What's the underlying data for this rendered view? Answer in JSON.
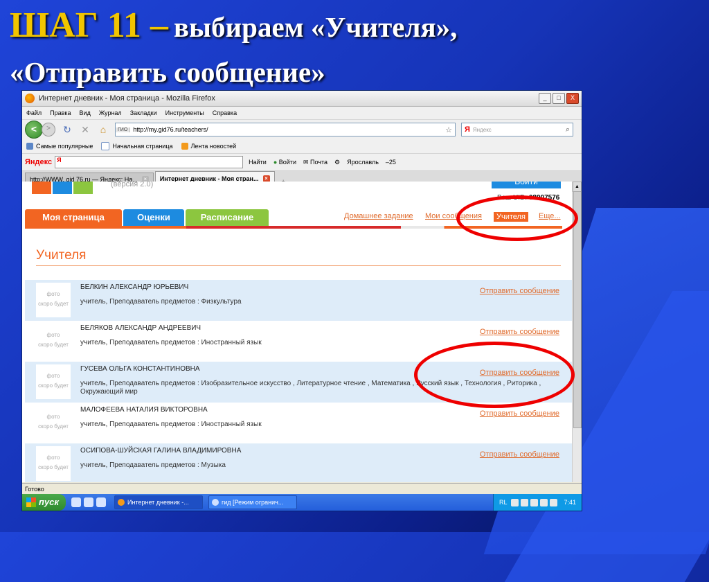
{
  "slide": {
    "title_step": "ШАГ 11 –",
    "title_rest": "выбираем «Учителя»,",
    "title_line2": "«Отправить сообщение»"
  },
  "window": {
    "title": "Интернет дневник - Моя страница - Mozilla Firefox",
    "buttons": [
      "_",
      "□",
      "X"
    ]
  },
  "menu": [
    "Файл",
    "Правка",
    "Вид",
    "Журнал",
    "Закладки",
    "Инструменты",
    "Справка"
  ],
  "nav": {
    "back": "<",
    "forward": ">",
    "url_prefix": "ГИО",
    "url": "http://my.gid76.ru/teachers/",
    "search_engine": "Я",
    "search_placeholder": "Яндекс"
  },
  "bookmarks": [
    "Самые популярные",
    "Начальная страница",
    "Лента новостей"
  ],
  "yandex_bar": {
    "logo": "Яндекс",
    "input_prefix": "Я",
    "items": [
      "Найти",
      "Войти",
      "Почта",
      "Ярославль",
      "–25"
    ]
  },
  "tabs": [
    {
      "label": "http://WWW. gid 76.ru — Яндекс: На...",
      "active": false
    },
    {
      "label": "Интернет дневник - Моя стран...",
      "active": true
    }
  ],
  "site": {
    "subtitle": "(версия 2.0)",
    "login_button": "Войти",
    "uid_label": "Ваш UID:",
    "uid_value": "08907576",
    "nav_tabs": [
      {
        "label": "Моя страница",
        "color": "#f26522"
      },
      {
        "label": "Оценки",
        "color": "#1d8be0"
      },
      {
        "label": "Расписание",
        "color": "#8cc63f"
      }
    ],
    "top_links": [
      "Домашнее задание",
      "Мои сообщения",
      "Учителя",
      "Еще..."
    ],
    "heading": "Учителя",
    "photo_placeholder": "фото\nскоро будет",
    "send_label": "Отправить сообщение",
    "teachers": [
      {
        "name": "БЕЛКИН АЛЕКСАНДР ЮРЬЕВИЧ",
        "desc": "учитель, Преподаватель предметов : Физкультура"
      },
      {
        "name": "БЕЛЯКОВ АЛЕКСАНДР АНДРЕЕВИЧ",
        "desc": "учитель, Преподаватель предметов : Иностранный язык"
      },
      {
        "name": "ГУСЕВА ОЛЬГА КОНСТАНТИНОВНА",
        "desc": "учитель, Преподаватель предметов : Изобразительное искусство , Литературное чтение , Математика , Русский язык , Технология , Риторика , Окружающий мир"
      },
      {
        "name": "МАЛОФЕЕВА НАТАЛИЯ ВИКТОРОВНА",
        "desc": "учитель, Преподаватель предметов : Иностранный язык"
      },
      {
        "name": "ОСИПОВА-ШУЙСКАЯ ГАЛИНА ВЛАДИМИРОВНА",
        "desc": "учитель, Преподаватель предметов : Музыка"
      }
    ]
  },
  "status": "Готово",
  "taskbar": {
    "start": "пуск",
    "tasks": [
      "Интернет дневник -...",
      "гид [Режим огранич..."
    ],
    "lang": "RL",
    "clock": "7:41"
  }
}
